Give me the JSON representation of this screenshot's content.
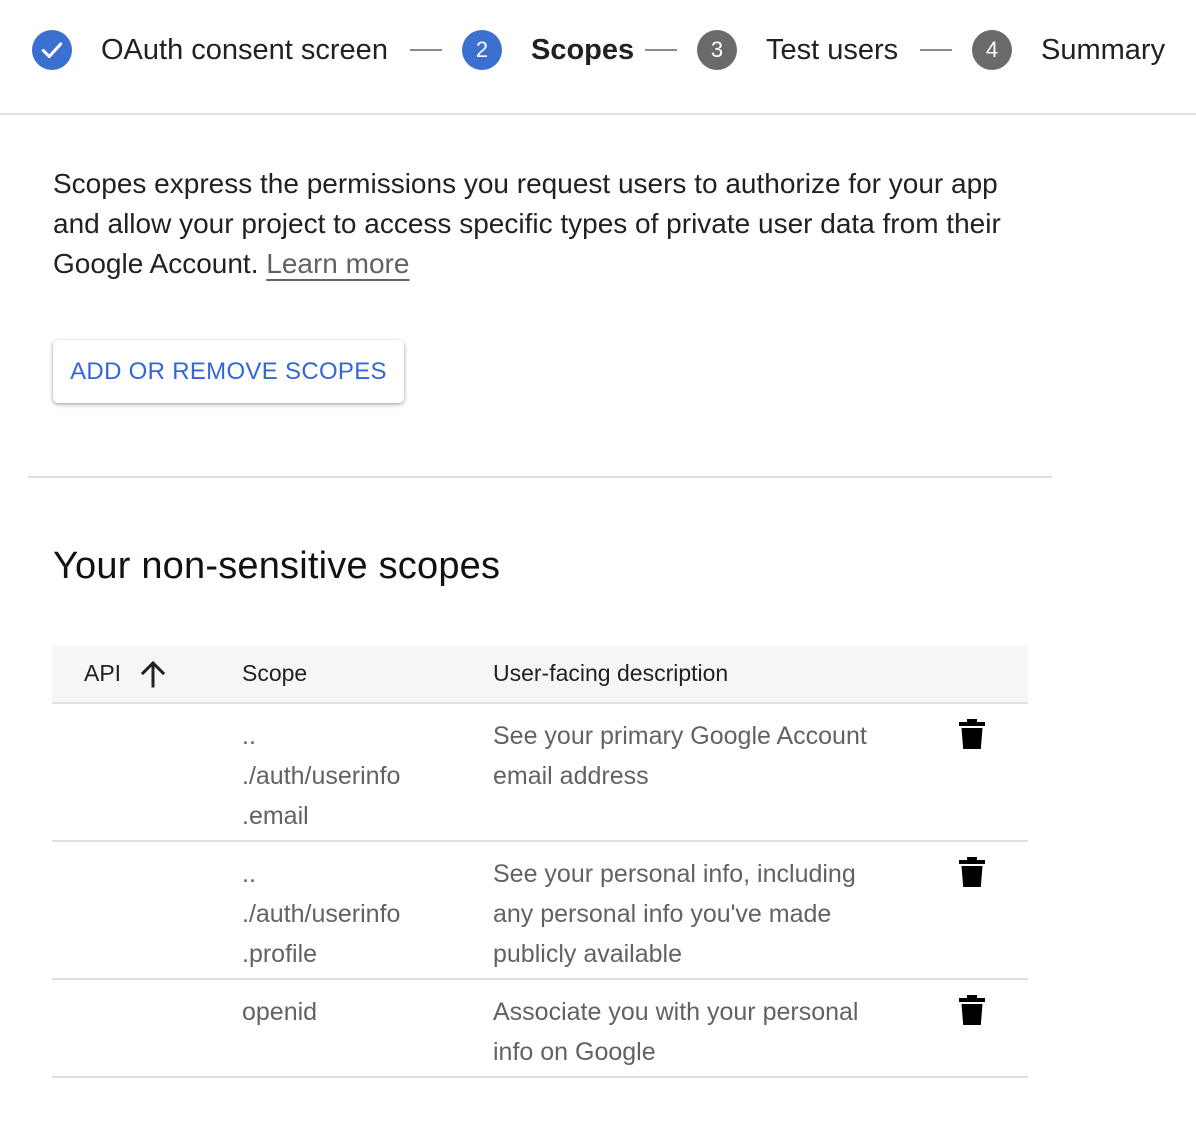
{
  "stepper": {
    "steps": [
      {
        "number": "",
        "label": "OAuth consent screen",
        "state": "done"
      },
      {
        "number": "2",
        "label": "Scopes",
        "state": "active"
      },
      {
        "number": "3",
        "label": "Test users",
        "state": "pending"
      },
      {
        "number": "4",
        "label": "Summary",
        "state": "pending"
      }
    ],
    "check_icon": "check-icon"
  },
  "intro": {
    "text": "Scopes express the permissions you request users to authorize for your app and allow your project to access specific types of private user data from their Google Account.",
    "learn_more": "Learn more"
  },
  "add_button": {
    "label": "ADD OR REMOVE SCOPES"
  },
  "section": {
    "title": "Your non-sensitive scopes"
  },
  "table": {
    "headers": {
      "api": "API",
      "scope": "Scope",
      "description": "User-facing description"
    },
    "sort_icon": "arrow-upward-icon",
    "delete_icon": "trash-icon",
    "rows": [
      {
        "api": "",
        "scope_lines": [
          "..",
          "./auth/userinfo",
          ".email"
        ],
        "description_lines": [
          "See your primary Google Account",
          "email address"
        ]
      },
      {
        "api": "",
        "scope_lines": [
          "..",
          "./auth/userinfo",
          ".profile"
        ],
        "description_lines": [
          "See your personal info, including",
          "any personal info you've made",
          "publicly available"
        ]
      },
      {
        "api": "",
        "scope_lines": [
          "openid"
        ],
        "description_lines": [
          "Associate you with your personal",
          "info on Google"
        ]
      }
    ]
  },
  "colors": {
    "accent": "#3b6fd0",
    "link_blue": "#3367d6",
    "pending": "#6a6a6a",
    "divider": "#e0e0e0"
  }
}
